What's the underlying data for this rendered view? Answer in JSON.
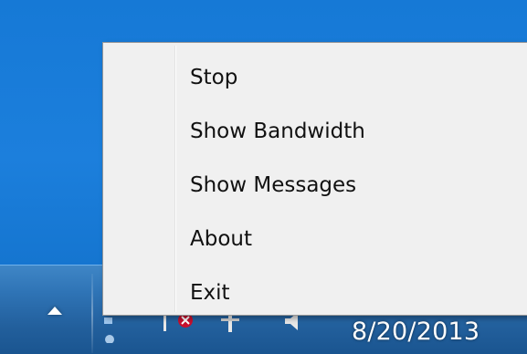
{
  "context_menu": {
    "items": [
      {
        "label": "Stop"
      },
      {
        "label": "Show Bandwidth"
      },
      {
        "label": "Show Messages"
      },
      {
        "label": "About"
      },
      {
        "label": "Exit"
      }
    ]
  },
  "taskbar": {
    "clock_date": "8/20/2013",
    "tray_icons": [
      "show-hidden-icons-arrow",
      "network-icon",
      "action-center-flag-icon",
      "power-icon",
      "volume-icon"
    ]
  },
  "colors": {
    "desktop": "#1c7fdc",
    "taskbar": "#2f74b6",
    "menu_background": "#f0f0f0",
    "menu_border": "#979797"
  }
}
